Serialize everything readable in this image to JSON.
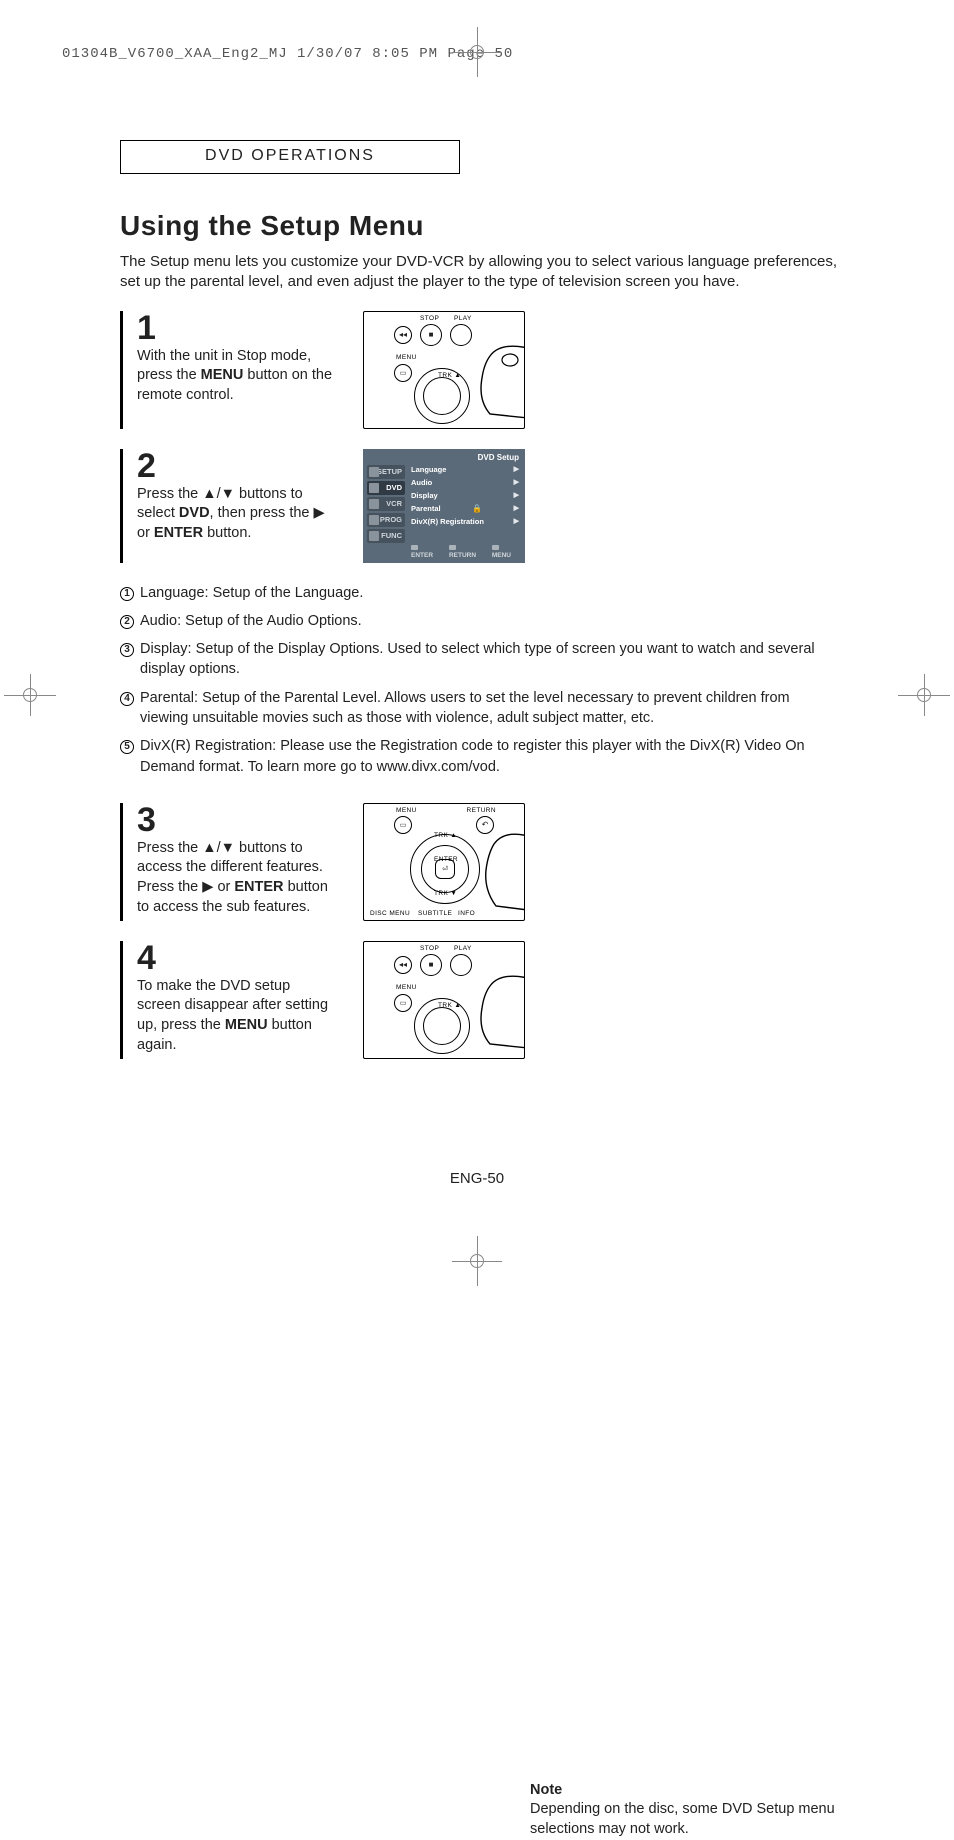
{
  "meta": {
    "print_header": "01304B_V6700_XAA_Eng2_MJ  1/30/07  8:05 PM  Page 50"
  },
  "section_header": "DVD OPERATIONS",
  "title": "Using the Setup Menu",
  "intro": "The Setup menu lets you customize your DVD-VCR by allowing you to select various language preferences, set up the parental level, and even adjust the player to the type of television screen you have.",
  "steps": {
    "s1": {
      "num": "1",
      "text_before": "With the unit in Stop mode, press the ",
      "bold": "MENU",
      "text_after": " button on the remote control."
    },
    "s2": {
      "num": "2",
      "line1_before": "Press the ▲/▼ buttons to select ",
      "line1_bold": "DVD",
      "line1_after": ", then press the ▶ or ",
      "line1_bold2": "ENTER",
      "line1_tail": " button."
    },
    "s3": {
      "num": "3",
      "line1": "Press the ▲/▼ buttons to access the different features. Press the ▶ or ",
      "bold": "ENTER",
      "tail": " button to access the sub features."
    },
    "s4": {
      "num": "4",
      "line1": "To make the DVD setup screen disappear after setting up, press the ",
      "bold": "MENU",
      "tail": " button again."
    }
  },
  "osd": {
    "title": "DVD Setup",
    "tabs": [
      "SETUP",
      "DVD",
      "VCR",
      "PROG",
      "FUNC"
    ],
    "items": [
      "Language",
      "Audio",
      "Display",
      "Parental",
      "DivX(R) Registration"
    ],
    "buttons": [
      "ENTER",
      "RETURN",
      "MENU"
    ]
  },
  "remote_labels": {
    "stop": "STOP",
    "play": "PLAY",
    "menu": "MENU",
    "return": "RETURN",
    "trk_up": "TRK ▲",
    "trk_dn": "TRK ▼",
    "enter": "ENTER",
    "discmenu": "DISC MENU",
    "subtitle": "SUBTITLE",
    "info": "INFO"
  },
  "bullets": {
    "b1": {
      "n": "1",
      "label": "Language:",
      "text": " Setup of the Language."
    },
    "b2": {
      "n": "2",
      "label": "Audio:",
      "text": " Setup of the Audio Options."
    },
    "b3": {
      "n": "3",
      "label": "Display:",
      "text": " Setup of the Display Options. Used to select which type of screen you want to watch and several display options."
    },
    "b4": {
      "n": "4",
      "label": "Parental:",
      "text": " Setup of the Parental Level. Allows users to set the level necessary to prevent children from viewing unsuitable movies such as those with violence, adult subject matter, etc."
    },
    "b5": {
      "n": "5",
      "label": " DivX(R) Registration:",
      "text": " Please use the Registration code to register this player with the DivX(R) Video On Demand format. To learn more go to www.divx.com/vod."
    }
  },
  "note": {
    "title": "Note",
    "body": "Depending on the disc, some DVD Setup menu selections may not work."
  },
  "page_number": "ENG-50"
}
